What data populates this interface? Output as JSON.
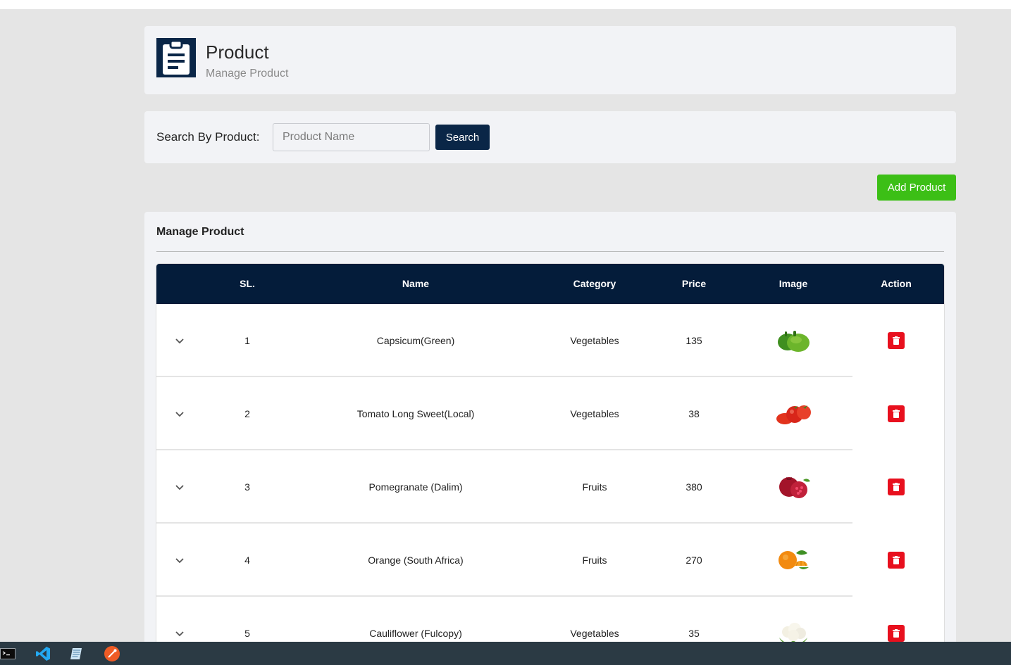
{
  "header": {
    "title": "Product",
    "subtitle": "Manage Product",
    "icon": "clipboard-icon"
  },
  "search": {
    "label": "Search By Product:",
    "placeholder": "Product Name",
    "value": "",
    "button_label": "Search"
  },
  "actions": {
    "add_label": "Add Product"
  },
  "table": {
    "section_title": "Manage Product",
    "columns": [
      "SL.",
      "Name",
      "Category",
      "Price",
      "Image",
      "Action"
    ],
    "rows": [
      {
        "sl": "1",
        "name": "Capsicum(Green)",
        "category": "Vegetables",
        "price": "135",
        "image": "green-capsicum-image"
      },
      {
        "sl": "2",
        "name": "Tomato Long Sweet(Local)",
        "category": "Vegetables",
        "price": "38",
        "image": "tomato-image"
      },
      {
        "sl": "3",
        "name": "Pomegranate (Dalim)",
        "category": "Fruits",
        "price": "380",
        "image": "pomegranate-image"
      },
      {
        "sl": "4",
        "name": "Orange (South Africa)",
        "category": "Fruits",
        "price": "270",
        "image": "orange-image"
      },
      {
        "sl": "5",
        "name": "Cauliflower (Fulcopy)",
        "category": "Vegetables",
        "price": "35",
        "image": "cauliflower-image"
      }
    ]
  },
  "taskbar": {
    "icons": [
      "terminal-icon",
      "vscode-icon",
      "notepad-icon",
      "postman-icon"
    ]
  },
  "colors": {
    "primary": "#0a2647",
    "table_header": "#041c3a",
    "add_button": "#3cbf16",
    "delete_button": "#e8101e",
    "background": "#e5e5e5",
    "card": "#f2f3f6"
  }
}
